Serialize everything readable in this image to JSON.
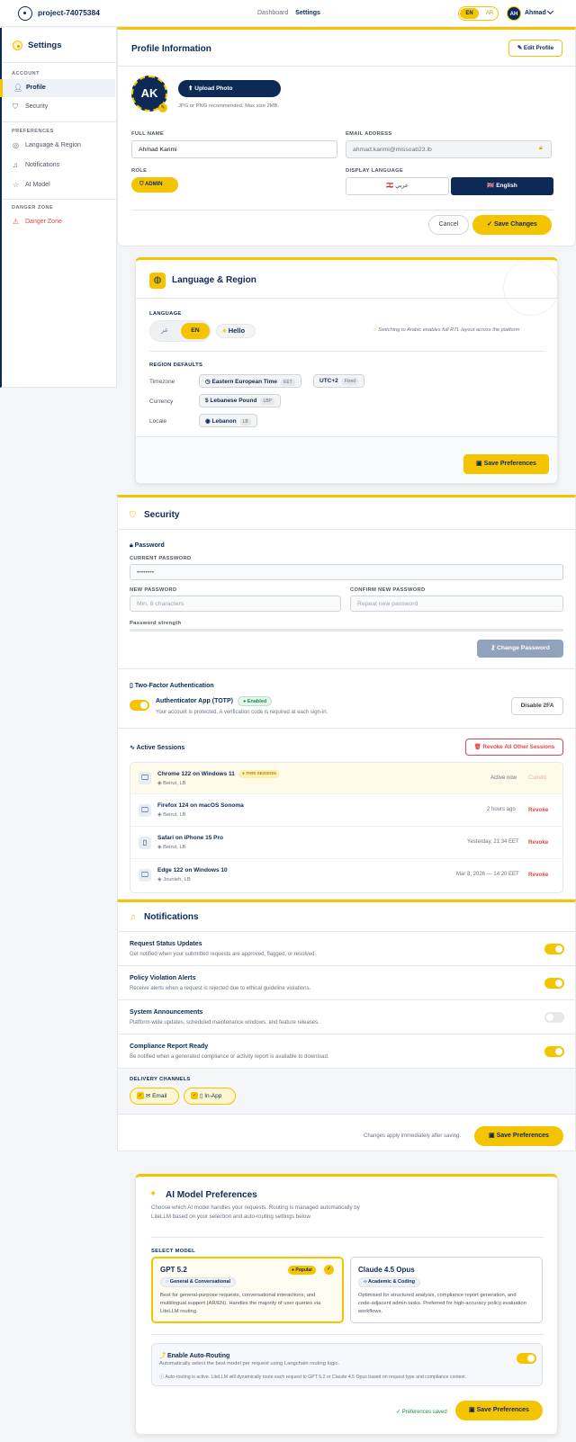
{
  "topbar": {
    "project": "project-74075384",
    "nav": [
      "Dashboard",
      "Settings"
    ],
    "lang_en": "EN",
    "lang_ar": "AR",
    "avatar": "AH",
    "user": "Ahmad"
  },
  "sidebar": {
    "title": "Settings",
    "account_head": "ACCOUNT",
    "prefs_head": "PREFERENCES",
    "danger_head": "DANGER ZONE",
    "items": [
      {
        "label": "Profile",
        "icon": "user-icon"
      },
      {
        "label": "Security",
        "icon": "shield-icon"
      },
      {
        "label": "Language & Region",
        "icon": "globe-icon"
      },
      {
        "label": "Notifications",
        "icon": "bell-icon"
      },
      {
        "label": "AI Model",
        "icon": "sparkle-icon"
      },
      {
        "label": "Danger Zone",
        "icon": "warning-icon"
      }
    ]
  },
  "profile": {
    "title": "Profile Information",
    "edit": "✎ Edit Profile",
    "initials": "AK",
    "upload": "⬆ Upload Photo",
    "upload_hint": "JPG or PNG recommended. Max size 2MB.",
    "full_name_label": "FULL NAME",
    "full_name": "Ahmad Karimi",
    "email_label": "EMAIL ADDRESS",
    "email": "ahmad.karimi@missoab23.lb",
    "role_label": "ROLE",
    "role": "ADMIN",
    "display_lang_label": "DISPLAY LANGUAGE",
    "lang_arabic": "عربي",
    "lang_english": "English",
    "cancel": "Cancel",
    "save": "✓  Save Changes"
  },
  "language": {
    "title": "Language & Region",
    "lang_label": "LANGUAGE",
    "opt_ar": "عر",
    "opt_en": "EN",
    "hello": "Hello",
    "rtl_note": "Switching to Arabic enables full RTL layout across the platform",
    "region_label": "REGION DEFAULTS",
    "rows": [
      {
        "label": "Timezone",
        "value": "Eastern European Time",
        "tag": "EET"
      },
      {
        "label": "Currency",
        "value": "Lebanese Pound",
        "tag": "LBP"
      },
      {
        "label": "Locale",
        "value": "Lebanon",
        "tag": "LB"
      }
    ],
    "utc": "UTC+2",
    "utc_tag": "Fixed",
    "save": "Save Preferences"
  },
  "security": {
    "title": "Security",
    "password_head": "Password",
    "current_label": "CURRENT PASSWORD",
    "current_value": "••••••••",
    "new_label": "NEW PASSWORD",
    "new_ph": "Min. 8 characters",
    "confirm_label": "CONFIRM NEW PASSWORD",
    "confirm_ph": "Repeat new password",
    "strength_label": "Password strength",
    "change": "Change Password",
    "twofa_head": "Two-Factor Authentication",
    "twofa_app": "Authenticator App (TOTP)",
    "twofa_badge": "● Enabled",
    "twofa_desc": "Your account is protected. A verification code is required at each sign-in.",
    "disable": "Disable 2FA",
    "sessions_head": "Active Sessions",
    "revoke_all": "Revoke All Other Sessions",
    "sessions": [
      {
        "device": "Chrome 122 on Windows 11",
        "badge": "● THIS SESSION",
        "loc": "Beirut, LB",
        "time": "Active now",
        "action": "Current"
      },
      {
        "device": "Firefox 124 on macOS Sonoma",
        "badge": "",
        "loc": "Beirut, LB",
        "time": "2 hours ago",
        "action": "Revoke"
      },
      {
        "device": "Safari on iPhone 15 Pro",
        "badge": "",
        "loc": "Beirut, LB",
        "time": "Yesterday, 21:34 EET",
        "action": "Revoke"
      },
      {
        "device": "Edge 122 on Windows 10",
        "badge": "",
        "loc": "Jounieh, LB",
        "time": "Mar 8, 2026 — 14:20 EET",
        "action": "Revoke"
      }
    ]
  },
  "notifications": {
    "title": "Notifications",
    "items": [
      {
        "title": "Request Status Updates",
        "desc": "Get notified when your submitted requests are approved, flagged, or resolved.",
        "on": true
      },
      {
        "title": "Policy Violation Alerts",
        "desc": "Receive alerts when a request is rejected due to ethical guideline violations.",
        "on": true
      },
      {
        "title": "System Announcements",
        "desc": "Platform-wide updates, scheduled maintenance windows, and feature releases.",
        "on": false
      },
      {
        "title": "Compliance Report Ready",
        "desc": "Be notified when a generated compliance or activity report is available to download.",
        "on": true
      }
    ],
    "channels_label": "DELIVERY CHANNELS",
    "channel_email": "Email",
    "channel_inapp": "In-App",
    "apply_note": "Changes apply immediately after saving.",
    "save": "Save Preferences"
  },
  "ai": {
    "title": "AI Model Preferences",
    "desc1": "Choose which AI model handles your requests. Routing is managed automatically by",
    "desc2": "LiteLLM based on your selection and auto-routing settings below.",
    "select_label": "SELECT MODEL",
    "models": [
      {
        "name": "GPT 5.2",
        "badge": "● Popular",
        "tag": "General & Conversational",
        "desc": [
          "Best for general-purpose requests, conversational interactions, and",
          "multilingual support (AR/EN). Handles the majority of user queries via",
          "LiteLLM routing."
        ]
      },
      {
        "name": "Claude 4.5 Opus",
        "badge": "",
        "tag": "Academic & Coding",
        "desc": [
          "Optimised for structured analysis, compliance report generation, and",
          "code-adjacent admin tasks. Preferred for high-accuracy policy evaluation",
          "workflows."
        ]
      }
    ],
    "auto_title": "Enable Auto-Routing",
    "auto_desc": "Automatically select the best model per request using Langchain routing logic.",
    "auto_note": "Auto-routing is active. LiteLLM will dynamically route each request to GPT 5.2 or Claude 4.5 Opus based on request type and compliance context.",
    "saved": "✓ Preferences saved",
    "save": "Save Preferences"
  },
  "colors": {
    "navy": "#0d2a57",
    "yellow": "#f5c400",
    "danger": "#e04848"
  }
}
